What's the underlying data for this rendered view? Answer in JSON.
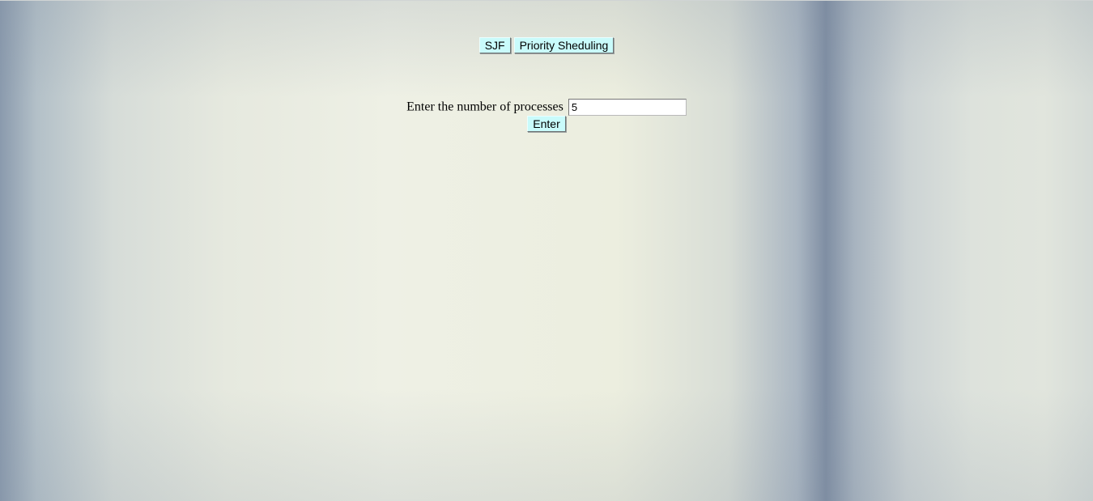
{
  "nav": {
    "sjf_label": "SJF",
    "priority_label": "Priority Sheduling"
  },
  "form": {
    "prompt": "Enter the number of processes",
    "process_count_value": "5",
    "enter_label": "Enter"
  },
  "colors": {
    "button_bg": "#c9fbfb"
  }
}
